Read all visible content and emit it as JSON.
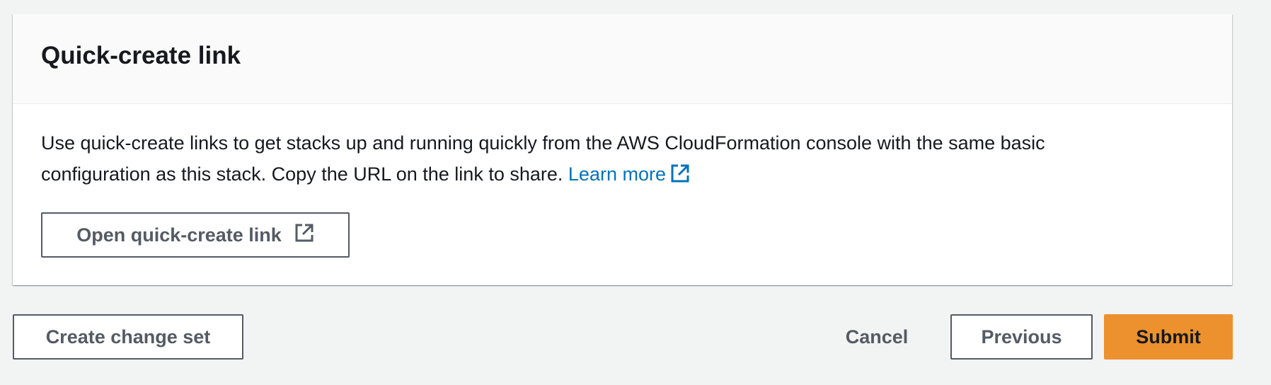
{
  "panel": {
    "title": "Quick-create link",
    "description": "Use quick-create links to get stacks up and running quickly from the AWS CloudFormation console with the same basic configuration as this stack. Copy the URL on the link to share.",
    "learn_more_label": "Learn more",
    "open_button_label": "Open quick-create link"
  },
  "footer": {
    "create_change_set_label": "Create change set",
    "cancel_label": "Cancel",
    "previous_label": "Previous",
    "submit_label": "Submit"
  },
  "colors": {
    "link": "#0073bb",
    "primary_button": "#ec912d",
    "outline_border": "#545b64",
    "page_background": "#f2f3f3"
  },
  "icons": {
    "external_link": "external-link-icon"
  }
}
